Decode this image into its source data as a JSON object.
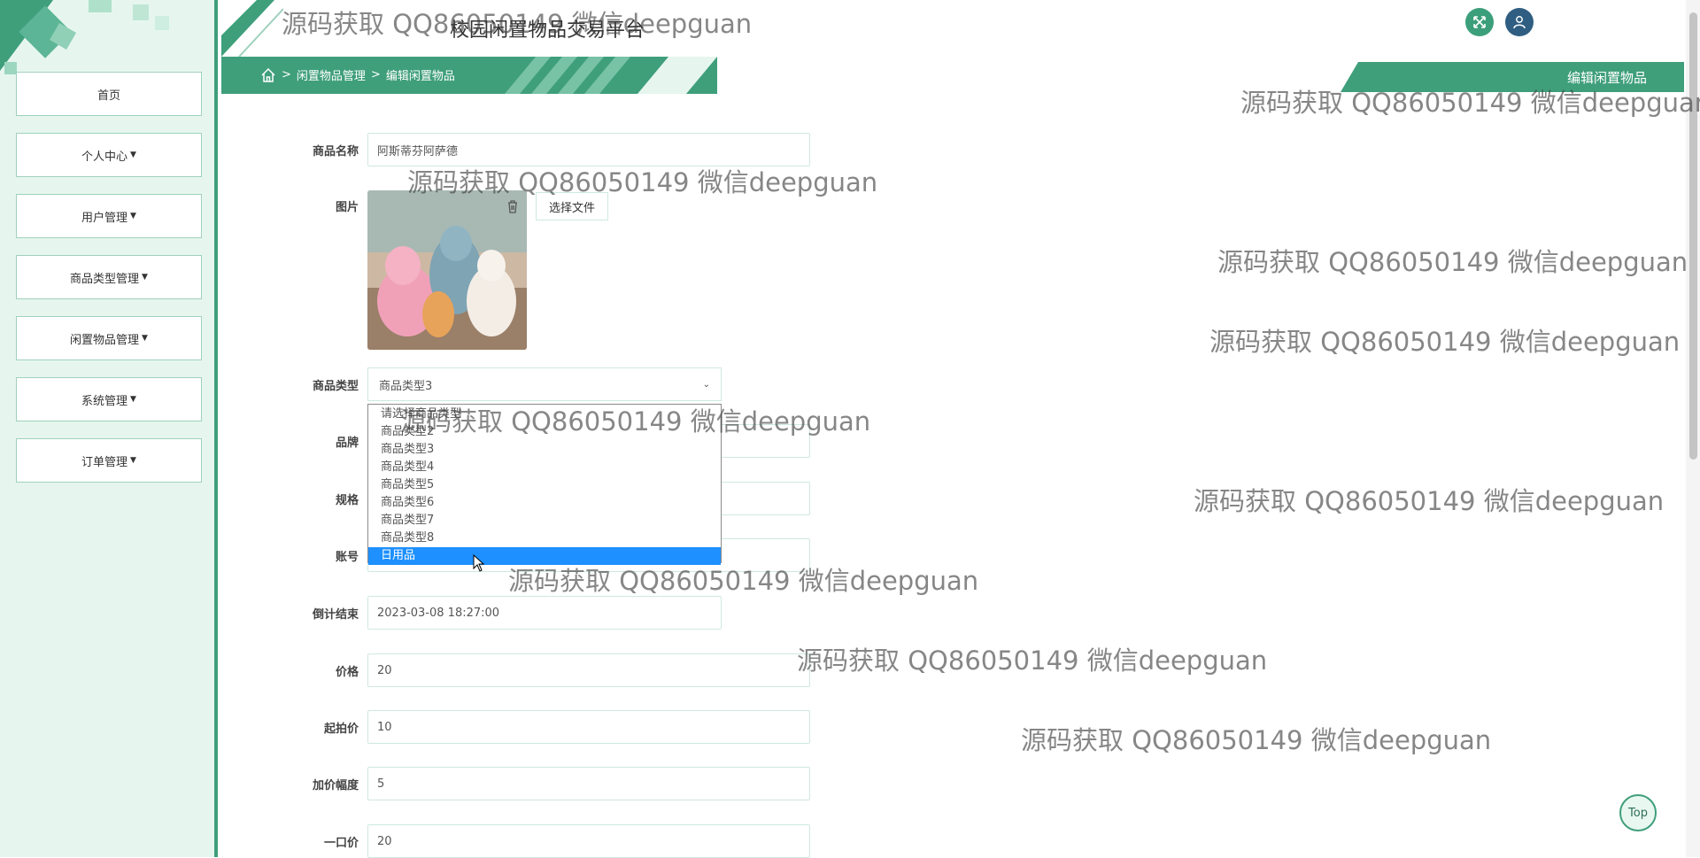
{
  "app": {
    "title": "校园闲置物品交易平台"
  },
  "sidebar": {
    "items": [
      {
        "label": "首页",
        "has_caret": false
      },
      {
        "label": "个人中心",
        "has_caret": true
      },
      {
        "label": "用户管理",
        "has_caret": true
      },
      {
        "label": "商品类型管理",
        "has_caret": true
      },
      {
        "label": "闲置物品管理",
        "has_caret": true
      },
      {
        "label": "系统管理",
        "has_caret": true
      },
      {
        "label": "订单管理",
        "has_caret": true
      }
    ]
  },
  "breadcrumb": {
    "sep": ">",
    "items": [
      "闲置物品管理",
      "编辑闲置物品"
    ]
  },
  "page": {
    "title": "编辑闲置物品"
  },
  "form": {
    "name": {
      "label": "商品名称",
      "value": "阿斯蒂芬阿萨德"
    },
    "image": {
      "label": "图片",
      "choose_label": "选择文件"
    },
    "category": {
      "label": "商品类型",
      "value": "商品类型3",
      "options": [
        "请选择商品类型",
        "商品类型2",
        "商品类型3",
        "商品类型4",
        "商品类型5",
        "商品类型6",
        "商品类型7",
        "商品类型8",
        "日用品"
      ],
      "highlighted": "日用品"
    },
    "brand": {
      "label": "品牌"
    },
    "spec": {
      "label": "规格"
    },
    "account": {
      "label": "账号"
    },
    "countdown": {
      "label": "倒计结束",
      "value": "2023-03-08 18:27:00"
    },
    "price": {
      "label": "价格",
      "value": "20"
    },
    "start_price": {
      "label": "起拍价",
      "value": "10"
    },
    "increment": {
      "label": "加价幅度",
      "value": "5"
    },
    "buyout": {
      "label": "一口价",
      "value": "20"
    }
  },
  "top_button": {
    "label": "Top"
  },
  "watermark": {
    "text": "源码获取 QQ86050149 微信deepguan"
  },
  "colors": {
    "primary": "#3f9f7b",
    "sidebar_bg": "#e6f6ef",
    "user_btn": "#2f5e82",
    "highlight": "#1e90ff"
  }
}
